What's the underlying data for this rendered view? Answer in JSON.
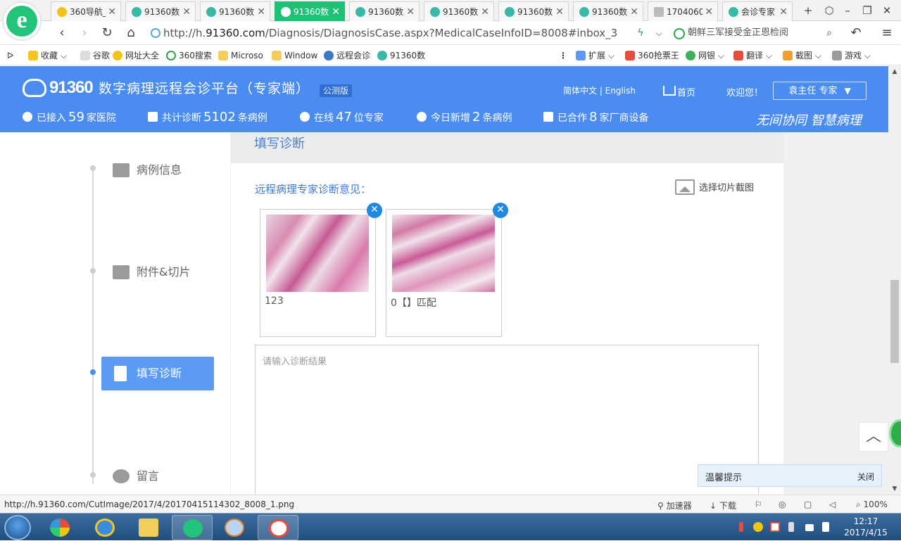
{
  "browser": {
    "tabs": [
      {
        "label": "360导航_"
      },
      {
        "label": "91360数"
      },
      {
        "label": "91360数"
      },
      {
        "label": "91360数"
      },
      {
        "label": "91360数"
      },
      {
        "label": "91360数"
      },
      {
        "label": "91360数"
      },
      {
        "label": "91360数"
      },
      {
        "label": "1704060"
      },
      {
        "label": "会诊专家"
      }
    ],
    "address": {
      "prefix": "http://h.",
      "domain": "91360.com",
      "path": "/Diagnosis/DiagnosisCase.aspx?MedicalCaseInfoID=8008#inbox_3"
    },
    "news": "朝鲜三军接受金正恩检阅",
    "bookmarks": [
      {
        "label": "收藏"
      },
      {
        "label": "谷歌"
      },
      {
        "label": "网址大全"
      },
      {
        "label": "360搜索"
      },
      {
        "label": "Microso"
      },
      {
        "label": "Window"
      },
      {
        "label": "远程会诊"
      },
      {
        "label": "91360数"
      },
      {
        "label": "扩展"
      },
      {
        "label": "360抢票王"
      },
      {
        "label": "网银"
      },
      {
        "label": "翻译"
      },
      {
        "label": "截图"
      },
      {
        "label": "游戏"
      }
    ]
  },
  "header": {
    "logo": "91360",
    "title": "数字病理远程会诊平台（专家端）",
    "badge": "公测版",
    "lang": "简体中文 | English",
    "home": "首页",
    "welcome": "欢迎您！",
    "user": "袁主任 专家",
    "slogan": "无间协同 智慧病理",
    "stats": [
      {
        "pre": "已接入",
        "num": "59",
        "post": "家医院"
      },
      {
        "pre": "共计诊断",
        "num": "5102",
        "post": "条病例"
      },
      {
        "pre": "在线",
        "num": "47",
        "post": "位专家"
      },
      {
        "pre": "今日新增",
        "num": "2",
        "post": "条病例"
      },
      {
        "pre": "已合作",
        "num": "8",
        "post": "家厂商设备"
      }
    ]
  },
  "sidenav": {
    "items": [
      {
        "label": "病例信息",
        "active": false
      },
      {
        "label": "附件&切片",
        "active": false
      },
      {
        "label": "填写诊断",
        "active": true
      },
      {
        "label": "留言",
        "active": false
      }
    ]
  },
  "main": {
    "section_title": "填写诊断",
    "diag_label": "远程病理专家诊断意见：",
    "pick_button": "选择切片截图",
    "images": [
      {
        "caption": "123"
      },
      {
        "caption": "0【】匹配"
      }
    ],
    "placeholder": "请输入诊断结果"
  },
  "notice": {
    "title": "温馨提示",
    "close": "关闭"
  },
  "statusbar": {
    "url": "http://h.91360.com/CutImage/2017/4/20170415114302_8008_1.png",
    "accelerator": "加速器",
    "download": "下载",
    "zoom": "100%"
  },
  "taskbar": {
    "time": "12:17",
    "date": "2017/4/15"
  }
}
